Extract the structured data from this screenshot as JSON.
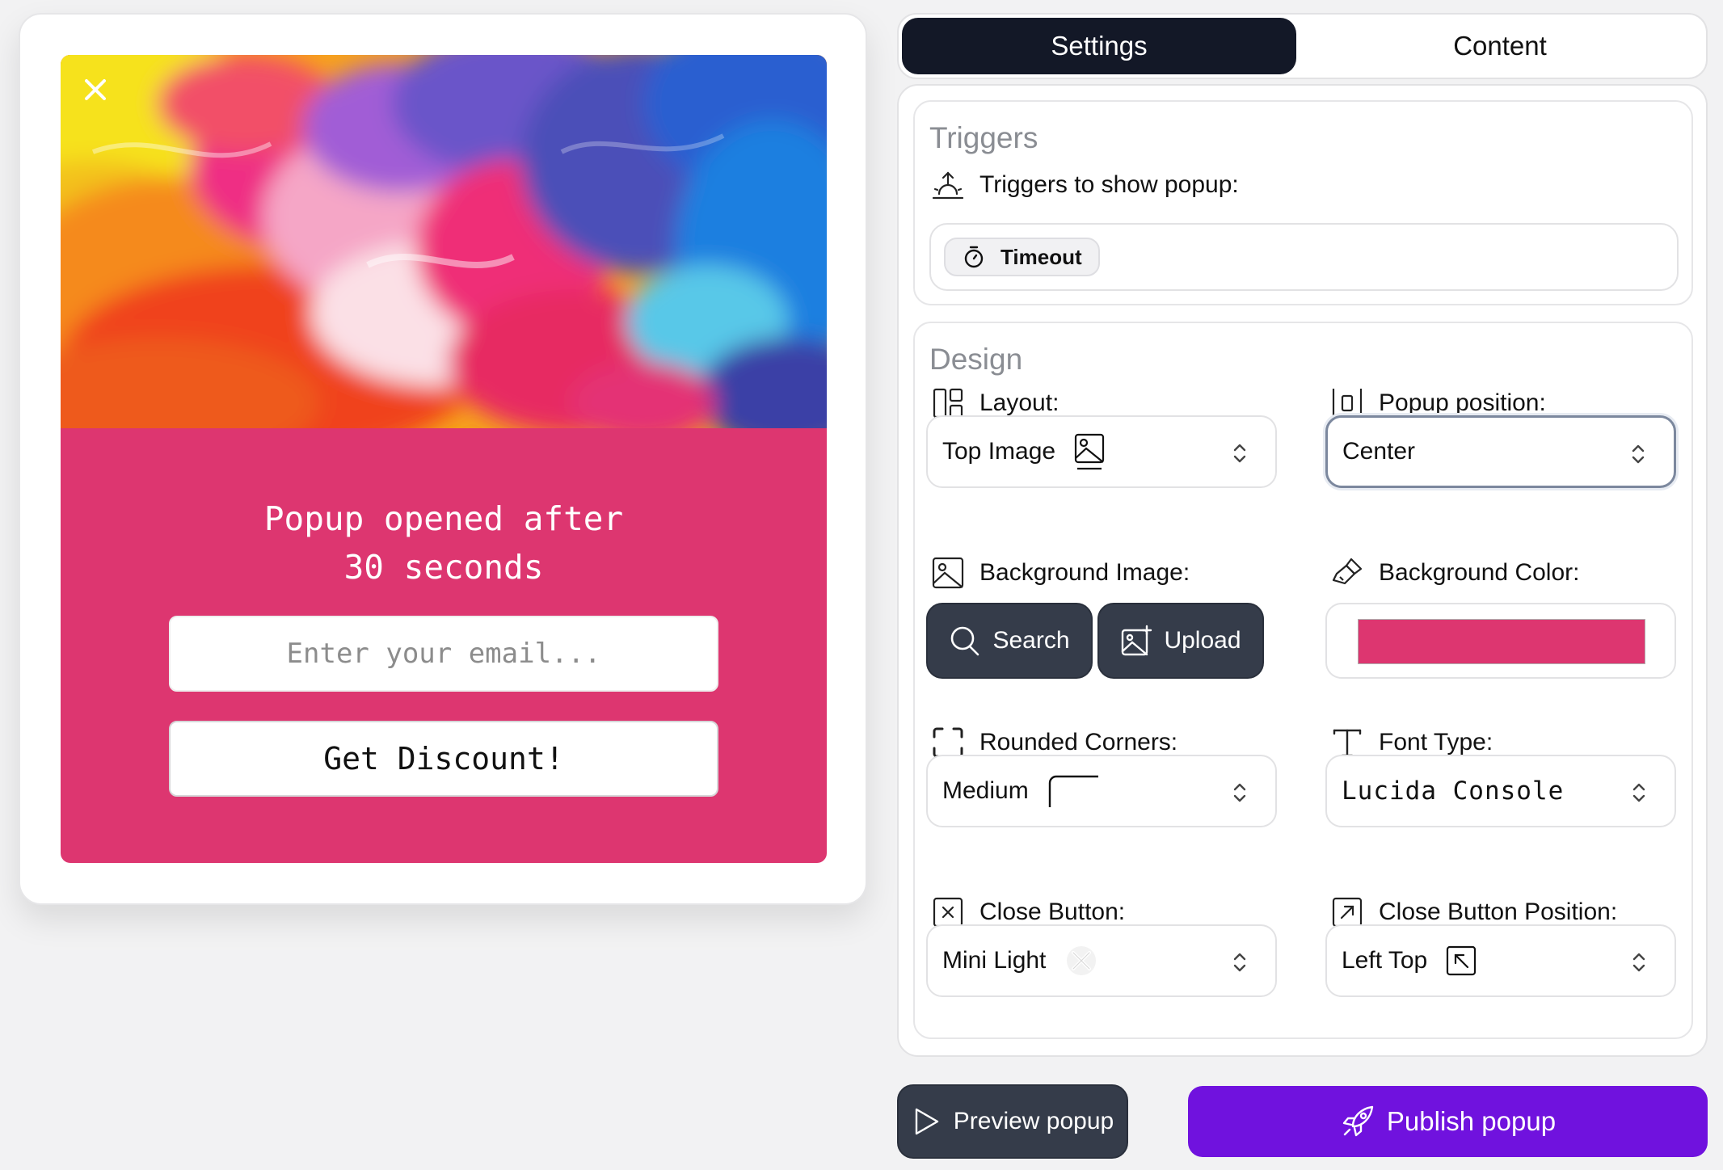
{
  "popup": {
    "title": "Popup opened after\n30 seconds",
    "email_placeholder": "Enter your email...",
    "button_label": "Get Discount!",
    "background_color": "#dd3670"
  },
  "tabs": [
    {
      "label": "Settings",
      "active": true
    },
    {
      "label": "Content",
      "active": false
    }
  ],
  "triggers": {
    "title": "Triggers",
    "label": "Triggers to show popup:",
    "chips": [
      {
        "label": "Timeout",
        "icon": "timer-icon"
      }
    ]
  },
  "design": {
    "title": "Design",
    "layout": {
      "label": "Layout:",
      "value": "Top Image",
      "icon": "layout-icon"
    },
    "position": {
      "label": "Popup position:",
      "value": "Center",
      "icon": "position-center-icon"
    },
    "background_image": {
      "label": "Background Image:",
      "search_label": "Search",
      "upload_label": "Upload"
    },
    "background_color": {
      "label": "Background Color:",
      "value": "#dd3670"
    },
    "rounded_corners": {
      "label": "Rounded Corners:",
      "value": "Medium"
    },
    "font_type": {
      "label": "Font Type:",
      "value": "Lucida Console"
    },
    "close_button": {
      "label": "Close Button:",
      "value": "Mini Light"
    },
    "close_button_position": {
      "label": "Close Button Position:",
      "value": "Left Top"
    }
  },
  "actions": {
    "preview_label": "Preview popup",
    "publish_label": "Publish popup",
    "publish_color": "#7012de"
  }
}
